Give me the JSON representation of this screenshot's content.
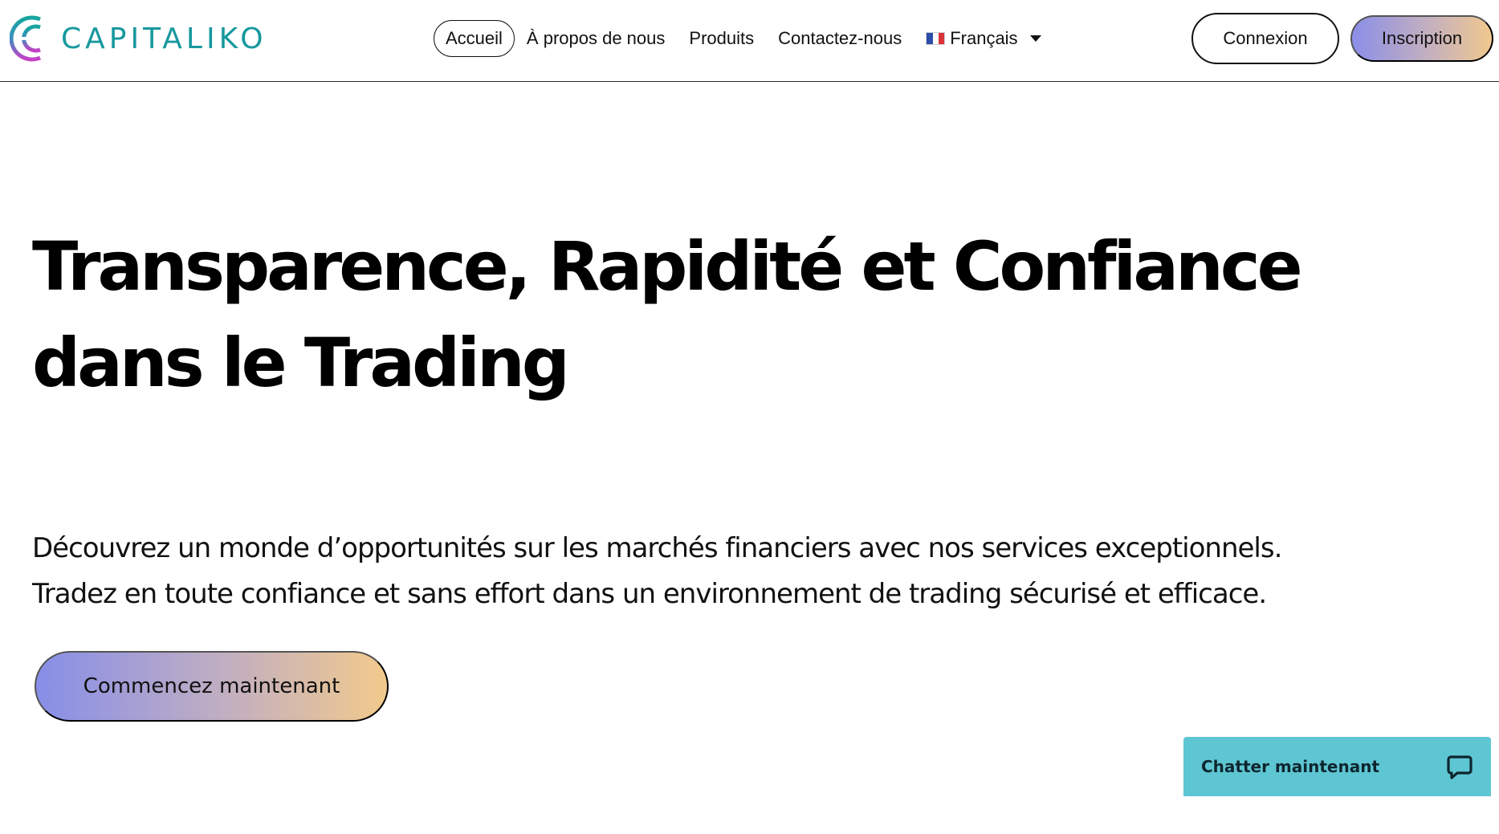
{
  "header": {
    "logo_text": "CAPITALIKO",
    "nav": [
      {
        "label": "Accueil",
        "active": true
      },
      {
        "label": "À propos de nous"
      },
      {
        "label": "Produits"
      },
      {
        "label": "Contactez-nous"
      }
    ],
    "language": {
      "label": "Français",
      "flag_colors": [
        "#2b4fa8",
        "#ffffff",
        "#d8323b"
      ]
    },
    "login_label": "Connexion",
    "signup_label": "Inscription"
  },
  "hero": {
    "title_line_1": "Transparence, Rapidité et Confiance",
    "title_line_2": "dans le Trading",
    "subtitle_line_1": "Découvrez un monde d’opportunités sur les marchés financiers avec nos services exceptionnels.",
    "subtitle_line_2": "Tradez en toute confiance et sans effort dans un environnement de trading sécurisé et efficace.",
    "cta_label": "Commencez maintenant"
  },
  "chat": {
    "label": "Chatter maintenant",
    "icon": "chat-bubble-icon"
  },
  "colors": {
    "brand_teal": "#17989e",
    "logo_magenta": "#c83fc7",
    "gradient_start": "#878ee8",
    "gradient_end": "#f2ca8c",
    "chat_bg": "#5ec6d2"
  }
}
